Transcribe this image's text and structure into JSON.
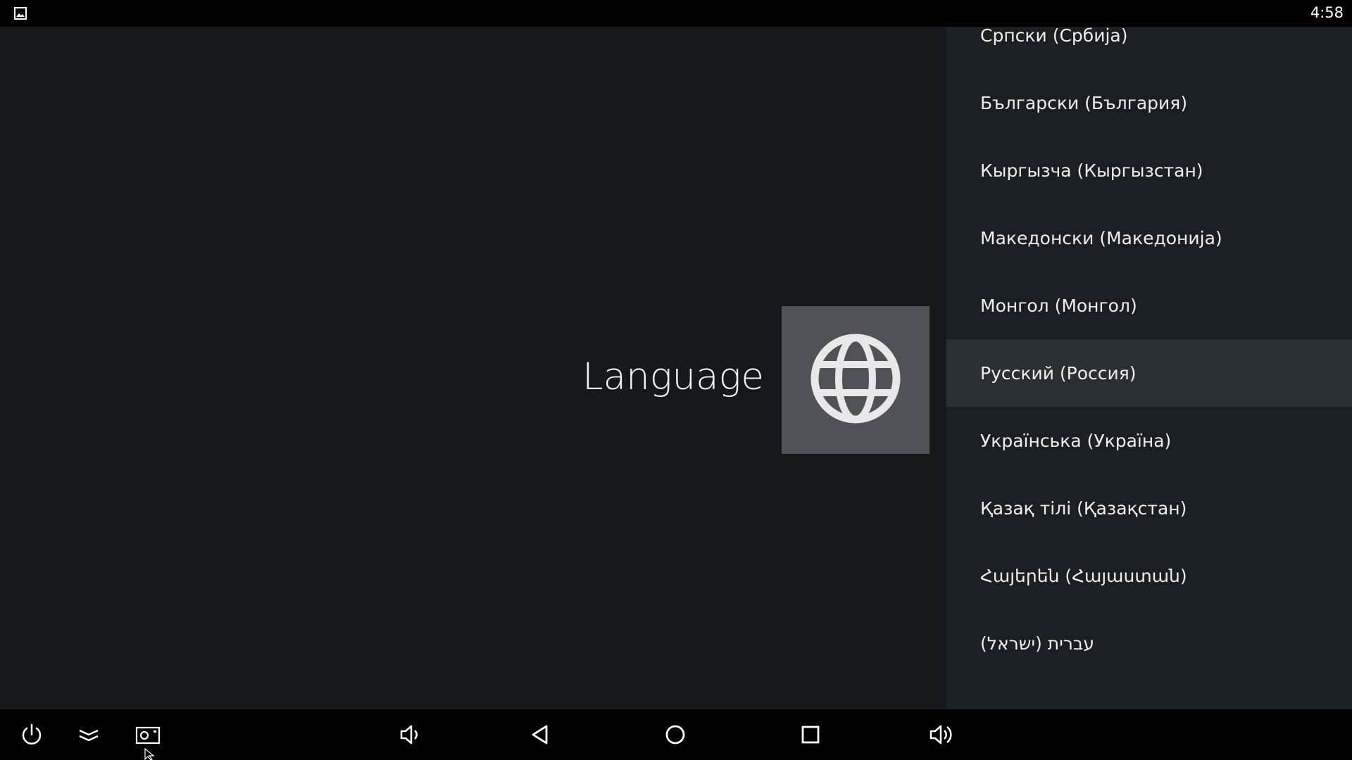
{
  "status_bar": {
    "time": "4:58",
    "left_icon": "gallery-icon"
  },
  "header": {
    "title": "Language",
    "icon": "globe-icon"
  },
  "language_list": {
    "items": [
      {
        "label": "Српски (Србија)",
        "selected": false
      },
      {
        "label": "Български (България)",
        "selected": false
      },
      {
        "label": "Кыргызча (Кыргызстан)",
        "selected": false
      },
      {
        "label": "Македонски (Македонија)",
        "selected": false
      },
      {
        "label": "Монгол (Монгол)",
        "selected": false
      },
      {
        "label": "Русский (Россия)",
        "selected": true
      },
      {
        "label": "Українська (Україна)",
        "selected": false
      },
      {
        "label": "Қазақ тілі (Қазақстан)",
        "selected": false
      },
      {
        "label": "Հայերեն (Հայաստան)",
        "selected": false
      },
      {
        "label": "עברית (ישראל)",
        "selected": false
      }
    ]
  },
  "nav_bar": {
    "buttons": [
      "power-icon",
      "collapse-icon",
      "screenshot-icon",
      "volume-down-icon",
      "back-icon",
      "home-icon",
      "recents-icon",
      "volume-up-icon"
    ]
  },
  "colors": {
    "background": "#15191c",
    "list_background": "#1a1f23",
    "selected_row": "#2a2f33",
    "icon_tile": "#4f5357",
    "bars": "#000000"
  }
}
